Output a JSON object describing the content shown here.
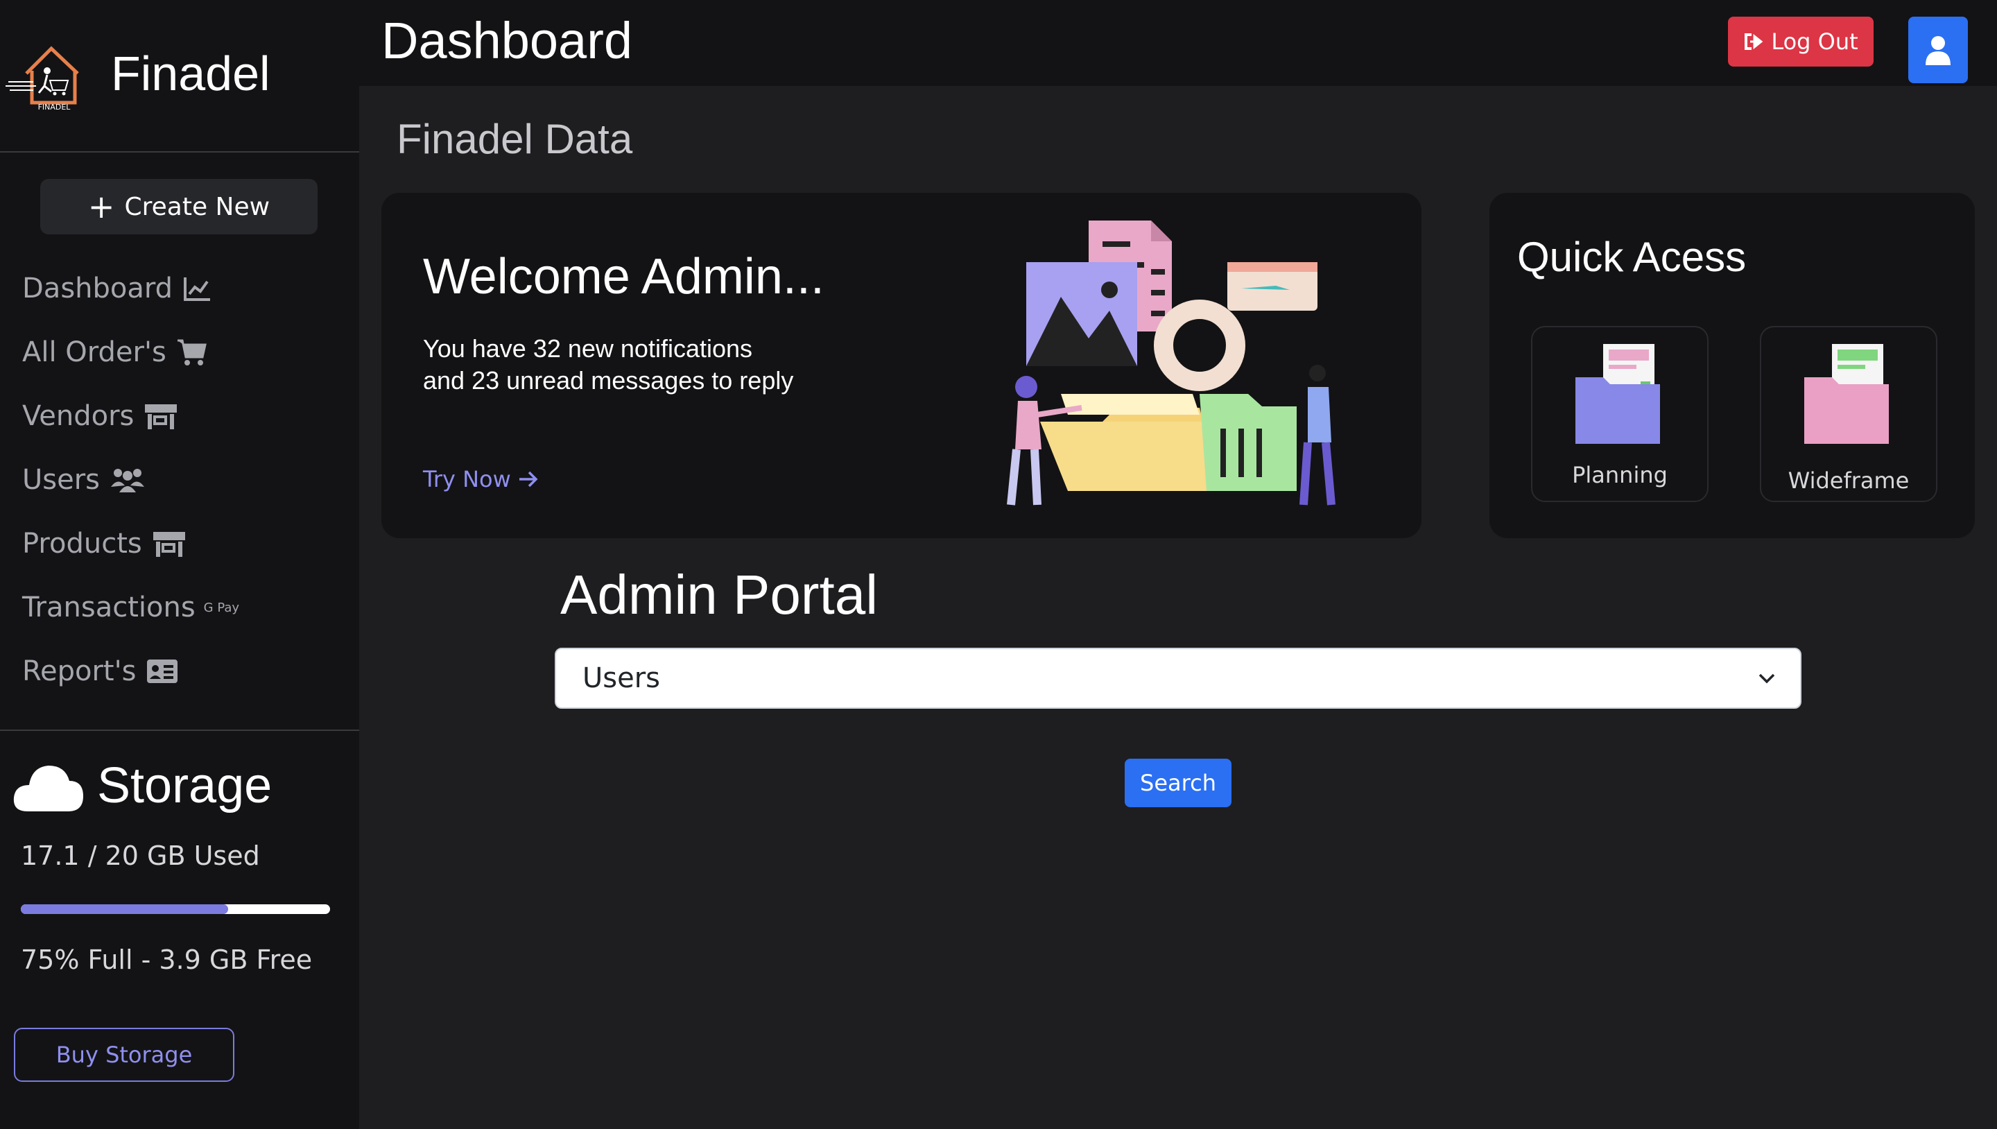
{
  "brand": {
    "name": "Finadel",
    "logo_text": "FINADEL"
  },
  "header": {
    "title": "Dashboard",
    "logout_label": "Log Out"
  },
  "sidebar": {
    "create_label": "Create New",
    "items": [
      {
        "label": "Dashboard",
        "icon": "chart-line-icon"
      },
      {
        "label": "All Order's",
        "icon": "cart-icon"
      },
      {
        "label": "Vendors",
        "icon": "store-icon"
      },
      {
        "label": "Users",
        "icon": "users-icon"
      },
      {
        "label": "Products",
        "icon": "store-icon"
      },
      {
        "label": "Transactions",
        "icon": "gpay-icon",
        "badge": "G Pay"
      },
      {
        "label": "Report's",
        "icon": "id-card-icon"
      }
    ]
  },
  "storage": {
    "title": "Storage",
    "used": "17.1 / 20 GB Used",
    "progress_fraction": 0.67,
    "free": "75% Full - 3.9 GB Free",
    "buy_label": "Buy Storage"
  },
  "main": {
    "section_title": "Finadel Data",
    "welcome": {
      "title": "Welcome Admin...",
      "text": "You have 32 new notifications\nand 23 unread messages to reply",
      "cta": "Try Now"
    },
    "quick_access": {
      "title": "Quick Acess",
      "tiles": [
        {
          "label": "Planning"
        },
        {
          "label": "Wideframe"
        }
      ]
    },
    "portal": {
      "title": "Admin Portal",
      "selected": "Users",
      "search_label": "Search"
    }
  },
  "colors": {
    "accent": "#7b7be0",
    "primary": "#2b6ff2",
    "danger": "#dc3545",
    "background": "#1e1e21",
    "panel": "#131315"
  }
}
